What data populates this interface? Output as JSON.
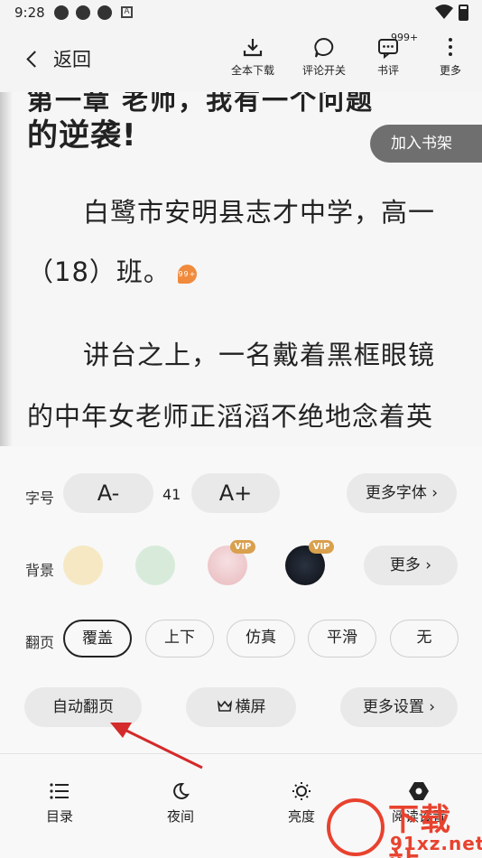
{
  "status_bar": {
    "time": "9:28",
    "app_icons": [
      "app-notification-icon",
      "app-notification-icon",
      "app-notification-icon"
    ],
    "a_badge": "A"
  },
  "header": {
    "back_label": "返回",
    "actions": [
      {
        "label": "全本下载",
        "icon": "download-icon"
      },
      {
        "label": "评论开关",
        "icon": "comment-toggle-icon"
      },
      {
        "label": "书评",
        "icon": "book-review-icon",
        "badge": "999+"
      },
      {
        "label": "更多",
        "icon": "more-vertical-icon"
      }
    ]
  },
  "reader": {
    "cut_line": "第一章 老师，我有一个问题",
    "heading": "的逆袭!",
    "paragraph_lines": [
      "白鹭市安明县志才中学，高一",
      "（18）班。",
      "讲台之上，一名戴着黑框眼镜",
      "的中年女老师正滔滔不绝地念着英"
    ],
    "comment_badge": "99+",
    "add_to_shelf": "加入书架"
  },
  "settings": {
    "font_size": {
      "label": "字号",
      "decrease": "A-",
      "value": "41",
      "increase": "A+",
      "more_fonts": "更多字体 ›"
    },
    "background": {
      "label": "背景",
      "swatches": [
        {
          "color": "#f6e8c3",
          "vip": false
        },
        {
          "color": "#d8ebdb",
          "vip": false
        },
        {
          "color": "#f3d6d8",
          "vip": true
        },
        {
          "color": "#151a22",
          "vip": true
        }
      ],
      "vip_label": "VIP",
      "more": "更多 ›"
    },
    "page_turn": {
      "label": "翻页",
      "options": [
        "覆盖",
        "上下",
        "仿真",
        "平滑",
        "无"
      ],
      "selected": "覆盖"
    },
    "auto_page": "自动翻页",
    "landscape": "横屏",
    "more_settings": "更多设置 ›"
  },
  "bottom_nav": [
    {
      "label": "目录",
      "icon": "list-icon"
    },
    {
      "label": "夜间",
      "icon": "moon-icon"
    },
    {
      "label": "亮度",
      "icon": "brightness-icon"
    },
    {
      "label": "阅读设置",
      "icon": "settings-gear-icon"
    }
  ],
  "annotation": {
    "color": "#d42a2a"
  },
  "watermark": {
    "text": "下载站",
    "url": "91xz.net",
    "color": "#e8422e"
  }
}
